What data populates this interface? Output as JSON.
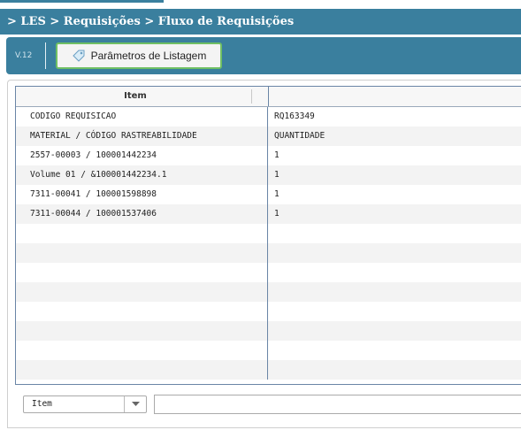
{
  "header": {
    "breadcrumb": "> LES > Requisições > Fluxo de Requisições"
  },
  "toolbar": {
    "version": "V.12",
    "params_button": "Parâmetros de Listagem",
    "params_icon": "tag-icon"
  },
  "table": {
    "columns": [
      "Item",
      ""
    ],
    "rows": [
      [
        "CODIGO REQUISICAO",
        "RQ163349"
      ],
      [
        "MATERIAL / CÓDIGO RASTREABILIDADE",
        "QUANTIDADE"
      ],
      [
        "2557-00003 / 100001442234",
        "1"
      ],
      [
        "Volume 01 / &100001442234.1",
        "1"
      ],
      [
        "7311-00041 / 100001598898",
        "1"
      ],
      [
        "7311-00044 / 100001537406",
        "1"
      ],
      [
        "",
        ""
      ],
      [
        "",
        ""
      ],
      [
        "",
        ""
      ],
      [
        "",
        ""
      ],
      [
        "",
        ""
      ],
      [
        "",
        ""
      ],
      [
        "",
        ""
      ],
      [
        "",
        ""
      ]
    ]
  },
  "footer": {
    "filter_select": "Item",
    "filter_value": ""
  },
  "colors": {
    "header_bg": "#3a7f9e",
    "button_border": "#6fbf63",
    "grid_border": "#6a85a6"
  }
}
